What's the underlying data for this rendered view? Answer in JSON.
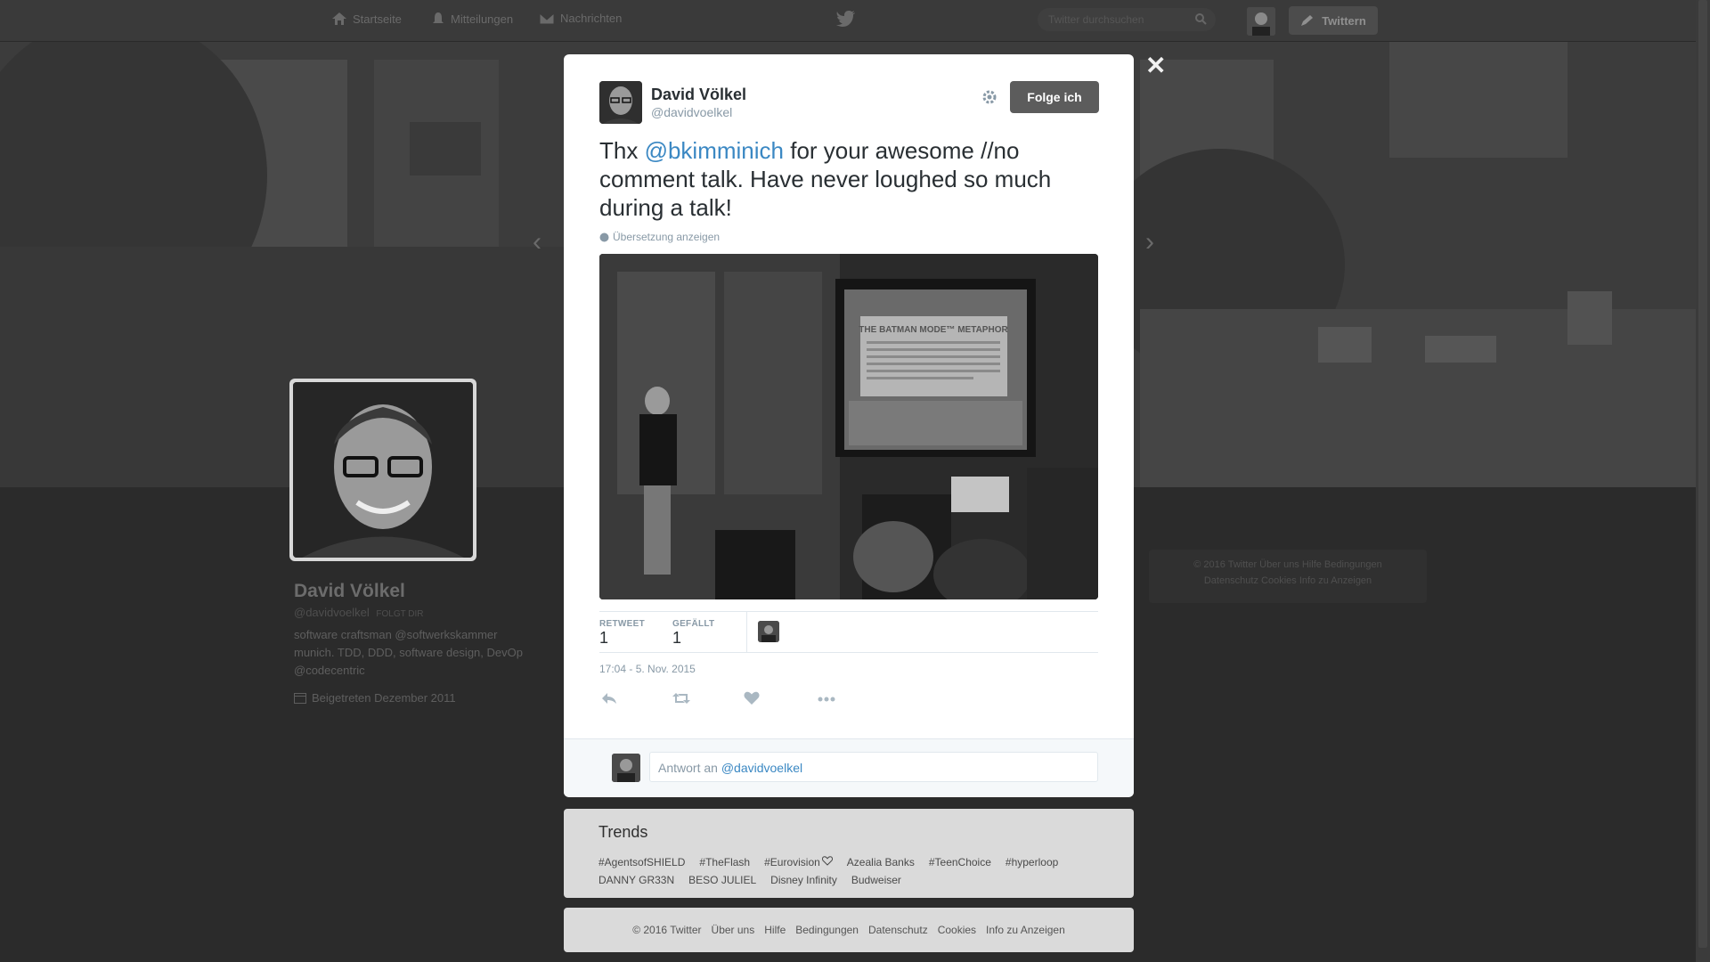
{
  "nav": {
    "home": "Startseite",
    "notifications": "Mitteilungen",
    "messages": "Nachrichten",
    "search_placeholder": "Twitter durchsuchen",
    "tweet_button": "Twittern"
  },
  "profile": {
    "name": "David Völkel",
    "handle": "@davidvoelkel",
    "follows_you": "FOLGT DIR",
    "bio_lines": [
      "software craftsman @softwerkskammer",
      "munich. TDD, DDD, software design, DevOp",
      "@codecentric"
    ],
    "joined": "Beigetreten Dezember 2011"
  },
  "side_footer": {
    "line1": "© 2016 Twitter   Über uns   Hilfe   Bedingungen",
    "line2": "Datenschutz   Cookies   Info zu Anzeigen"
  },
  "tweet": {
    "name": "David Völkel",
    "handle": "@davidvoelkel",
    "follow_label": "Folge ich",
    "text_before": "Thx ",
    "mention": "@bkimminich",
    "text_after": " for your awesome //no comment talk. Have never loughed so much during a talk!",
    "translate": "Übersetzung anzeigen",
    "slide_title": "THE BATMAN MODE™ METAPHOR",
    "retweet_label": "RETWEET",
    "retweet_count": "1",
    "like_label": "GEFÄLLT",
    "like_count": "1",
    "timestamp": "17:04 - 5. Nov. 2015",
    "reply_placeholder": "Antwort an ",
    "reply_mention": "@davidvoelkel"
  },
  "trends": {
    "title": "Trends",
    "row1": [
      "#AgentsofSHIELD",
      "#TheFlash",
      "#Eurovision",
      "Azealia Banks",
      "#TeenChoice",
      "#hyperloop"
    ],
    "row2": [
      "DANNY GR33N",
      "BESO JULIEL",
      "Disney Infinity",
      "Budweiser"
    ]
  },
  "footer": [
    "© 2016 Twitter",
    "Über uns",
    "Hilfe",
    "Bedingungen",
    "Datenschutz",
    "Cookies",
    "Info zu Anzeigen"
  ],
  "colors": {
    "mention": "#3b88c3",
    "overlay": "#2b2b2b"
  }
}
